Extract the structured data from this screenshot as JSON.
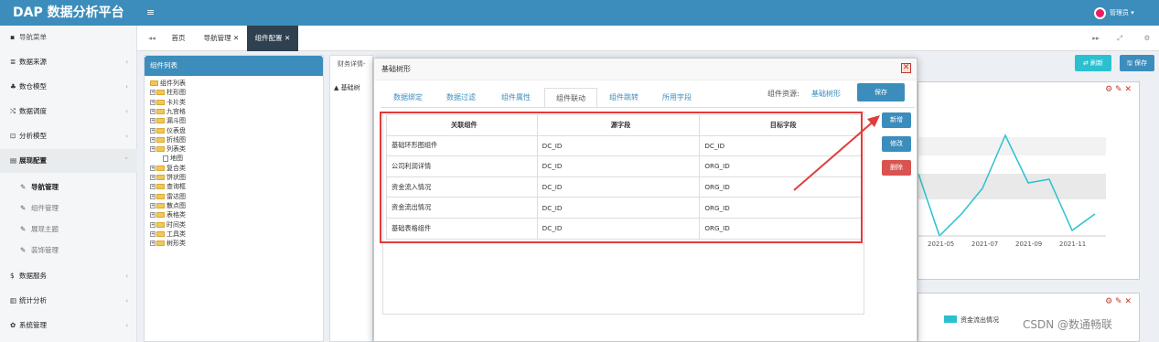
{
  "topbar": {
    "brand": "DAP 数据分析平台",
    "menu_toggle": "≡",
    "user": "管理员 ▾"
  },
  "sidebar": {
    "header": "导航菜单",
    "items": [
      {
        "icon": "≣",
        "label": "数据来源",
        "chev": "‹"
      },
      {
        "icon": "♣",
        "label": "数仓模型",
        "chev": "‹"
      },
      {
        "icon": "⤭",
        "label": "数据调度",
        "chev": "‹"
      },
      {
        "icon": "⊡",
        "label": "分析模型",
        "chev": "‹"
      },
      {
        "icon": "▤",
        "label": "展现配置",
        "chev": "ˇ"
      },
      {
        "icon": "$",
        "label": "数据服务",
        "chev": "‹"
      },
      {
        "icon": "▥",
        "label": "统计分析",
        "chev": "‹"
      },
      {
        "icon": "✿",
        "label": "系统管理",
        "chev": "‹"
      }
    ],
    "subitems": [
      {
        "icon": "✎",
        "label": "导航管理"
      },
      {
        "icon": "✎",
        "label": "组件管理"
      },
      {
        "icon": "✎",
        "label": "展现主题"
      },
      {
        "icon": "✎",
        "label": "装饰管理"
      }
    ]
  },
  "tabbar": {
    "back": "◂◂",
    "tabs": [
      "首页",
      "导航管理 ✕",
      "组件配置 ✕"
    ],
    "fwd": "▸▸",
    "expand": "⤢",
    "gear": "⚙"
  },
  "left_panel": {
    "title": "组件列表",
    "tree": [
      {
        "t": "root",
        "label": "组件列表"
      },
      {
        "t": "fold",
        "label": "柱形图"
      },
      {
        "t": "fold",
        "label": "卡片类"
      },
      {
        "t": "fold",
        "label": "九宫格"
      },
      {
        "t": "fold",
        "label": "漏斗图"
      },
      {
        "t": "fold",
        "label": "仪表盘"
      },
      {
        "t": "fold",
        "label": "折线图"
      },
      {
        "t": "fold",
        "label": "列表类"
      },
      {
        "t": "doc",
        "label": "地图"
      },
      {
        "t": "fold",
        "label": "复合类"
      },
      {
        "t": "fold",
        "label": "饼状图"
      },
      {
        "t": "fold",
        "label": "查询框"
      },
      {
        "t": "fold",
        "label": "雷达图"
      },
      {
        "t": "fold",
        "label": "散点图"
      },
      {
        "t": "fold",
        "label": "表格类"
      },
      {
        "t": "fold",
        "label": "时间类"
      },
      {
        "t": "fold",
        "label": "工具类"
      },
      {
        "t": "fold",
        "label": "树形类"
      }
    ]
  },
  "center": {
    "tab": "财务详情-"
  },
  "right": {
    "refresh": "⇄ 刷新",
    "save": "🖫 保存",
    "chart": {
      "x_labels": [
        "2021-05",
        "2021-07",
        "2021-09",
        "2021-11"
      ],
      "legend": "资金流出情况"
    }
  },
  "dialog": {
    "title": "基础树形",
    "close": "✕",
    "tabs": [
      "数据绑定",
      "数据过滤",
      "组件属性",
      "组件联动",
      "组件跳转",
      "所用字段"
    ],
    "resource_label": "组件资源:",
    "resource_value": "基础树形",
    "save": "保存",
    "table": {
      "headers": [
        "关联组件",
        "源字段",
        "目标字段"
      ],
      "rows": [
        [
          "基础环形图组件",
          "DC_ID",
          "DC_ID"
        ],
        [
          "公司利润详情",
          "DC_ID",
          "ORG_ID"
        ],
        [
          "资金流入情况",
          "DC_ID",
          "ORG_ID"
        ],
        [
          "资金流出情况",
          "DC_ID",
          "ORG_ID"
        ],
        [
          "基础表格组件",
          "DC_ID",
          "ORG_ID"
        ]
      ]
    },
    "buttons": {
      "add": "新增",
      "edit": "修改",
      "delete": "删除"
    }
  },
  "watermark": "CSDN @数通畅联",
  "colors": {
    "topbar": "#3c8dbc",
    "active_tab": "#2f4050",
    "danger": "#e03c3c",
    "primary": "#3c8dbc",
    "teal": "#2bc0d0"
  }
}
